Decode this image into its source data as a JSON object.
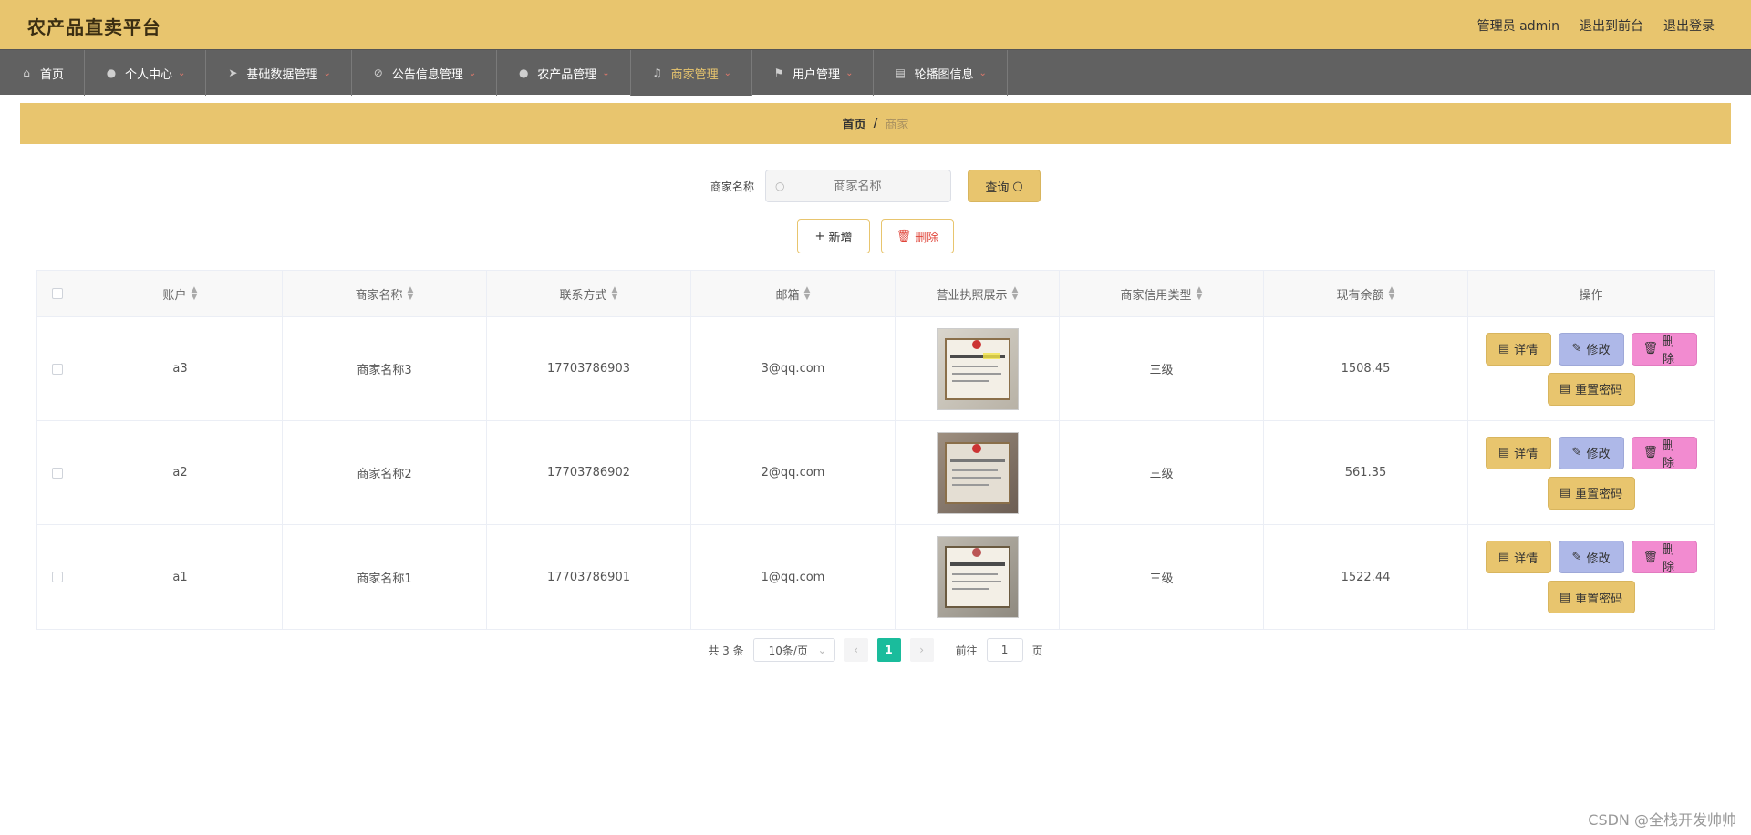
{
  "brand": "农产品直卖平台",
  "top_links": {
    "admin": "管理员 admin",
    "front": "退出到前台",
    "logout": "退出登录"
  },
  "nav": [
    {
      "label": "首页",
      "icon": "home-icon",
      "caret": false
    },
    {
      "label": "个人中心",
      "icon": "user-icon",
      "caret": true
    },
    {
      "label": "基础数据管理",
      "icon": "send-icon",
      "caret": true
    },
    {
      "label": "公告信息管理",
      "icon": "bell-off-icon",
      "caret": true
    },
    {
      "label": "农产品管理",
      "icon": "user-icon",
      "caret": true
    },
    {
      "label": "商家管理",
      "icon": "microphone-icon",
      "caret": true,
      "active": true
    },
    {
      "label": "用户管理",
      "icon": "flag-icon",
      "caret": true
    },
    {
      "label": "轮播图信息",
      "icon": "clipboard-icon",
      "caret": true
    }
  ],
  "breadcrumb": {
    "home": "首页",
    "sep": "/",
    "current": "商家"
  },
  "search": {
    "label": "商家名称",
    "placeholder": "商家名称",
    "button": "查询"
  },
  "actions": {
    "add": "新增",
    "delete": "删除"
  },
  "table": {
    "headers": [
      "账户",
      "商家名称",
      "联系方式",
      "邮箱",
      "营业执照展示",
      "商家信用类型",
      "现有余额",
      "操作"
    ],
    "rows": [
      {
        "account": "a3",
        "name": "商家名称3",
        "phone": "17703786903",
        "email": "3@qq.com",
        "credit": "三级",
        "balance": "1508.45"
      },
      {
        "account": "a2",
        "name": "商家名称2",
        "phone": "17703786902",
        "email": "2@qq.com",
        "credit": "三级",
        "balance": "561.35"
      },
      {
        "account": "a1",
        "name": "商家名称1",
        "phone": "17703786901",
        "email": "1@qq.com",
        "credit": "三级",
        "balance": "1522.44"
      }
    ],
    "row_actions": {
      "detail": "详情",
      "edit": "修改",
      "delete": "删除",
      "reset": "重置密码"
    }
  },
  "pagination": {
    "total": "共 3 条",
    "page_size": "10条/页",
    "current": "1",
    "goto_label": "前往",
    "goto_value": "1",
    "page_unit": "页"
  },
  "watermark": "CSDN @全栈开发帅帅",
  "colors": {
    "accent": "#e8c56e",
    "nav_bg": "#616161",
    "edit": "#aeb8e8",
    "delete": "#f28bd0",
    "page_active": "#1abc9c"
  }
}
